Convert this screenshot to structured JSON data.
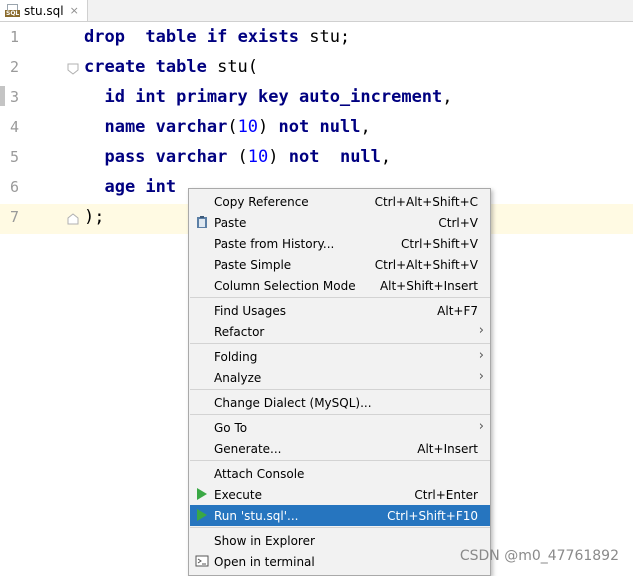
{
  "tab": {
    "label": "stu.sql",
    "badge": "SQL",
    "close": "×"
  },
  "editor": {
    "lines": [
      {
        "num": "1",
        "tokens": [
          {
            "t": "drop  ",
            "c": "kw"
          },
          {
            "t": "table ",
            "c": "kw"
          },
          {
            "t": "if ",
            "c": "kw"
          },
          {
            "t": "exists ",
            "c": "kw"
          },
          {
            "t": "stu;",
            "c": "plain"
          }
        ]
      },
      {
        "num": "2",
        "tokens": [
          {
            "t": "create ",
            "c": "kw"
          },
          {
            "t": "table ",
            "c": "kw"
          },
          {
            "t": "stu(",
            "c": "plain"
          }
        ]
      },
      {
        "num": "3",
        "tokens": [
          {
            "t": "  id ",
            "c": "kw"
          },
          {
            "t": "int ",
            "c": "kw"
          },
          {
            "t": "primary ",
            "c": "kw"
          },
          {
            "t": "key ",
            "c": "kw"
          },
          {
            "t": "auto_increment",
            "c": "kw"
          },
          {
            "t": ",",
            "c": "plain"
          }
        ]
      },
      {
        "num": "4",
        "tokens": [
          {
            "t": "  name ",
            "c": "kw"
          },
          {
            "t": "varchar",
            "c": "kw"
          },
          {
            "t": "(",
            "c": "plain"
          },
          {
            "t": "10",
            "c": "num"
          },
          {
            "t": ") ",
            "c": "plain"
          },
          {
            "t": "not ",
            "c": "kw"
          },
          {
            "t": "null",
            "c": "kw"
          },
          {
            "t": ",",
            "c": "plain"
          }
        ]
      },
      {
        "num": "5",
        "tokens": [
          {
            "t": "  pass ",
            "c": "kw"
          },
          {
            "t": "varchar ",
            "c": "kw"
          },
          {
            "t": "(",
            "c": "plain"
          },
          {
            "t": "10",
            "c": "num"
          },
          {
            "t": ") ",
            "c": "plain"
          },
          {
            "t": "not  ",
            "c": "kw"
          },
          {
            "t": "null",
            "c": "kw"
          },
          {
            "t": ",",
            "c": "plain"
          }
        ]
      },
      {
        "num": "6",
        "tokens": [
          {
            "t": "  age ",
            "c": "kw"
          },
          {
            "t": "int",
            "c": "kw"
          }
        ]
      },
      {
        "num": "7",
        "tokens": [
          {
            "t": ");",
            "c": "plain"
          }
        ]
      }
    ]
  },
  "menu": {
    "items": [
      {
        "label": "Copy Reference",
        "shortcut": "Ctrl+Alt+Shift+C"
      },
      {
        "label": "Paste",
        "shortcut": "Ctrl+V",
        "icon": "clipboard-icon"
      },
      {
        "label": "Paste from History...",
        "shortcut": "Ctrl+Shift+V"
      },
      {
        "label": "Paste Simple",
        "shortcut": "Ctrl+Alt+Shift+V"
      },
      {
        "label": "Column Selection Mode",
        "shortcut": "Alt+Shift+Insert"
      },
      {
        "label": "Find Usages",
        "shortcut": "Alt+F7"
      },
      {
        "label": "Refactor",
        "arrow": "›"
      },
      {
        "label": "Folding",
        "arrow": "›"
      },
      {
        "label": "Analyze",
        "arrow": "›"
      },
      {
        "label": "Change Dialect (MySQL)..."
      },
      {
        "label": "Go To",
        "arrow": "›"
      },
      {
        "label": "Generate...",
        "shortcut": "Alt+Insert"
      },
      {
        "label": "Attach Console"
      },
      {
        "label": "Execute",
        "shortcut": "Ctrl+Enter",
        "icon": "play-icon"
      },
      {
        "label": "Run 'stu.sql'...",
        "shortcut": "Ctrl+Shift+F10",
        "icon": "play-icon",
        "highlighted": true
      },
      {
        "label": "Show in Explorer"
      },
      {
        "label": "Open in terminal",
        "icon": "terminal-icon"
      }
    ]
  },
  "watermark": "CSDN @m0_47761892",
  "colors": {
    "keyword": "#000080",
    "number": "#0000ff",
    "highlight": "#2675bf",
    "current_line": "#fffae3",
    "play_green": "#3aa845"
  }
}
